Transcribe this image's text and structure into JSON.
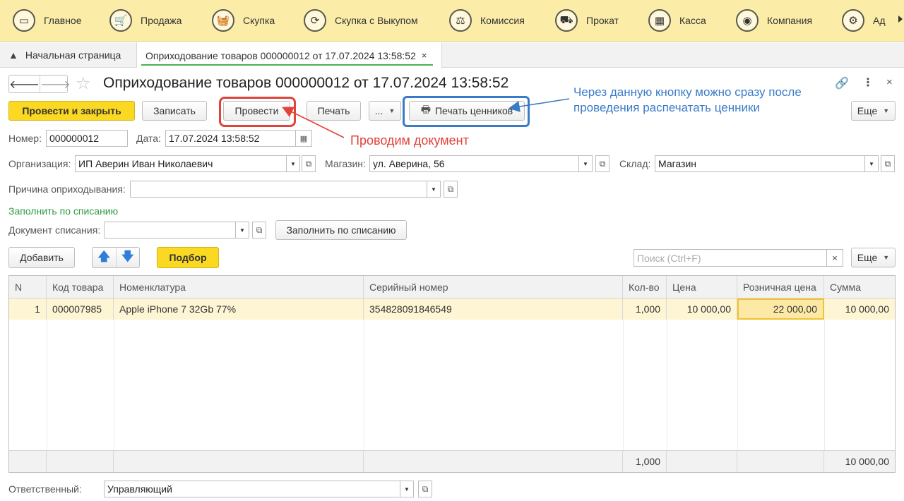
{
  "sections": [
    {
      "label": "Главное",
      "icon": "monitor-icon",
      "glyph": "▭"
    },
    {
      "label": "Продажа",
      "icon": "cart-icon",
      "glyph": "🛒"
    },
    {
      "label": "Скупка",
      "icon": "basket-icon",
      "glyph": "🧺"
    },
    {
      "label": "Скупка с Выкупом",
      "icon": "refresh-icon",
      "glyph": "⟳"
    },
    {
      "label": "Комиссия",
      "icon": "scales-icon",
      "glyph": "⚖"
    },
    {
      "label": "Прокат",
      "icon": "rent-icon",
      "glyph": "⛟"
    },
    {
      "label": "Касса",
      "icon": "cash-register-icon",
      "glyph": "▦"
    },
    {
      "label": "Компания",
      "icon": "company-icon",
      "glyph": "◉"
    },
    {
      "label": "Ад",
      "icon": "admin-icon",
      "glyph": "⚙"
    }
  ],
  "tabs": {
    "home": "Начальная страница",
    "doc": "Оприходование товаров 000000012 от 17.07.2024 13:58:52",
    "close": "×"
  },
  "title": "Оприходование товаров 000000012 от 17.07.2024 13:58:52",
  "toolbar": {
    "post_close": "Провести и закрыть",
    "save": "Записать",
    "post": "Провести",
    "print": "Печать",
    "more_dots": "...",
    "print_labels": "Печать ценников",
    "more": "Еще"
  },
  "annotations": {
    "red_note": "Проводим документ",
    "blue_note": "Через данную кнопку можно сразу после проведения распечатать ценники",
    "red_color": "#e2423a",
    "blue_color": "#3a7bc8"
  },
  "fields": {
    "number_label": "Номер:",
    "number_value": "000000012",
    "date_label": "Дата:",
    "date_value": "17.07.2024 13:58:52",
    "org_label": "Организация:",
    "org_value": "ИП Аверин Иван Николаевич",
    "store_label": "Магазин:",
    "store_value": "ул. Аверина, 56",
    "warehouse_label": "Склад:",
    "warehouse_value": "Магазин",
    "reason_label": "Причина оприходывания:",
    "reason_value": "",
    "fill_link": "Заполнить по списанию",
    "writeoff_label": "Документ списания:",
    "writeoff_value": "",
    "fill_button": "Заполнить по списанию",
    "responsible_label": "Ответственный:",
    "responsible_value": "Управляющий"
  },
  "table_toolbar": {
    "add": "Добавить",
    "up": "🡅",
    "down": "🡇",
    "pick": "Подбор",
    "search_placeholder": "Поиск (Ctrl+F)",
    "clear": "×",
    "more": "Еще"
  },
  "table": {
    "headers": [
      "N",
      "Код товара",
      "Номенклатура",
      "Серийный номер",
      "Кол-во",
      "Цена",
      "Розничная цена",
      "Сумма"
    ],
    "rows": [
      [
        "1",
        "000007985",
        "Apple iPhone 7 32Gb 77%",
        "354828091846549",
        "1,000",
        "10 000,00",
        "22 000,00",
        "10 000,00"
      ]
    ],
    "footer": {
      "qty": "1,000",
      "sum": "10 000,00"
    }
  },
  "colors": {
    "accent_yellow": "#fbd923",
    "section_bar": "#fbeda8",
    "link_green": "#2f9b42",
    "tab_underline": "#4caf50"
  }
}
